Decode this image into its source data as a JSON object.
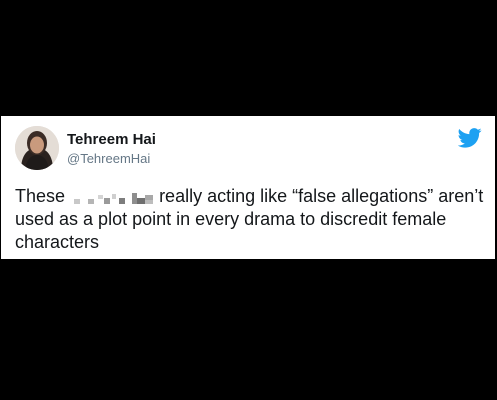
{
  "tweet": {
    "author_name": "Tehreem Hai",
    "author_handle": "@TehreemHai",
    "text_before_censor": "These",
    "text_after_censor": "really acting like “false allegations” aren’t used as a plot point in every drama to discredit female characters"
  },
  "icons": {
    "brand": "twitter-bird-icon",
    "avatar": "profile-photo"
  },
  "colors": {
    "background": "#000000",
    "card": "#ffffff",
    "name_text": "#14171a",
    "handle_text": "#657786",
    "twitter_blue": "#1da1f2",
    "censor_gray": "#9e9e9e"
  }
}
